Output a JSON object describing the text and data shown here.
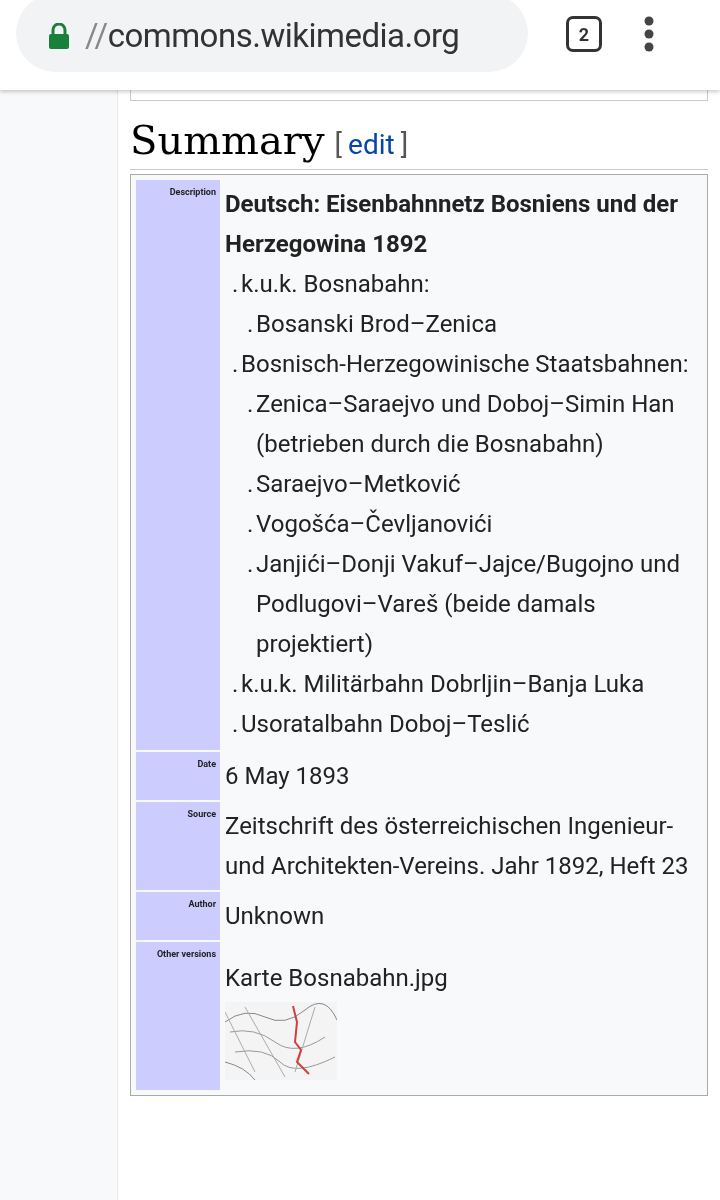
{
  "browser": {
    "url_prefix": "//",
    "url": "commons.wikimedia.org",
    "tab_count": "2"
  },
  "section": {
    "title": "Summary",
    "edit_open": "[",
    "edit_link": "edit",
    "edit_close": "]"
  },
  "rows": [
    {
      "kind": "description",
      "label": "Description",
      "heading": "Deutsch: Eisenbahnnetz Bosniens und der Herzegowina 1892",
      "items": [
        {
          "marker": ".",
          "text": "k.u.k. Bosnabahn:",
          "children": [
            {
              "marker": ".",
              "text": "Bosanski Brod–Zenica"
            }
          ]
        },
        {
          "marker": ".",
          "text": "Bosnisch-Herzegowinische Staatsbahnen:",
          "children": [
            {
              "marker": ".",
              "text": "Zenica–Saraejvo und Doboj–Simin Han (betrieben durch die Bosnabahn)"
            },
            {
              "marker": ".",
              "text": "Saraejvo–Metković"
            },
            {
              "marker": ".",
              "text": "Vogošća–Čevljanovići"
            },
            {
              "marker": ".",
              "text": "Janjići–Donji Vakuf–Jajce/Bugojno und Podlugovi–Vareš (beide damals projektiert)"
            }
          ]
        },
        {
          "marker": ".",
          "text": "k.u.k. Militärbahn Dobrljin–Banja Luka"
        },
        {
          "marker": ".",
          "text": "Usoratalbahn Doboj–Teslić"
        }
      ]
    },
    {
      "kind": "text",
      "label": "Date",
      "value": "6 May 1893"
    },
    {
      "kind": "text",
      "label": "Source",
      "value": "Zeitschrift des österreichischen Ingenieur- und Architekten-Vereins. Jahr 1892, Heft 23"
    },
    {
      "kind": "text",
      "label": "Author",
      "value": "Unknown"
    },
    {
      "kind": "file",
      "label": "Other versions",
      "value": "Karte Bosnabahn.jpg"
    }
  ]
}
